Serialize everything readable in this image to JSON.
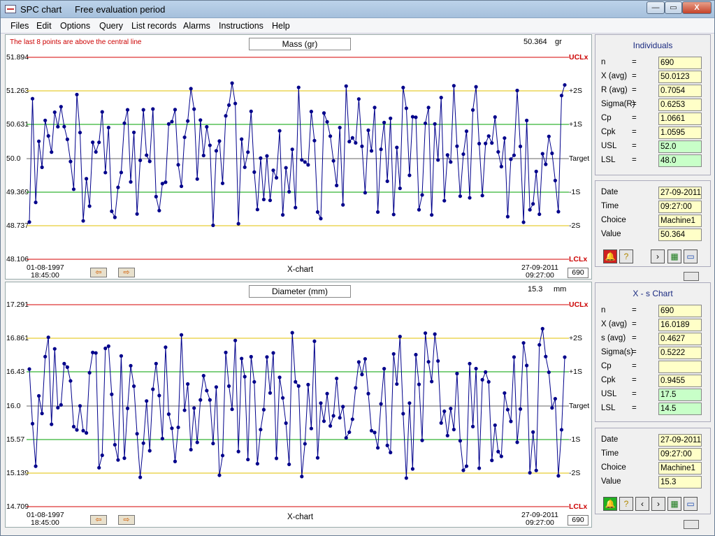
{
  "window": {
    "app_title": "SPC chart",
    "subtitle": "Free evaluation period",
    "min_glyph": "—",
    "max_glyph": "▭",
    "close_glyph": "X"
  },
  "menu": [
    "Files",
    "Edit",
    "Options",
    "Query",
    "List records",
    "Alarms",
    "Instructions",
    "Help"
  ],
  "colors": {
    "ucl": "#d40000",
    "s2": "#e0c000",
    "s1": "#00a000",
    "target": "#666666",
    "series": "#00008b",
    "alarm": "#e00000"
  },
  "chart1": {
    "alert": "The last 8 points are above the central line",
    "title": "Mass (gr)",
    "current_value": "50.364",
    "unit": "gr",
    "y_labels": [
      "51.894",
      "51.263",
      "50.631",
      "50.0",
      "49.369",
      "48.737",
      "48.106"
    ],
    "right_labels": [
      "UCLx",
      "+2S",
      "+1S",
      "Target",
      "-1S",
      "-2S",
      "LCLx"
    ],
    "start_date": "01-08-1997",
    "start_time": "18:45:00",
    "end_date": "27-09-2011",
    "end_time": "09:27:00",
    "chart_name": "X-chart",
    "count": "690"
  },
  "chart2": {
    "title": "Diameter (mm)",
    "current_value": "15.3",
    "unit": "mm",
    "y_labels": [
      "17.291",
      "16.861",
      "16.43",
      "16.0",
      "15.57",
      "15.139",
      "14.709"
    ],
    "right_labels": [
      "UCLx",
      "+2S",
      "+1S",
      "Target",
      "-1S",
      "-2S",
      "LCLx"
    ],
    "start_date": "01-08-1997",
    "start_time": "18:45:00",
    "end_date": "27-09-2011",
    "end_time": "09:27:00",
    "chart_name": "X-chart",
    "count": "690"
  },
  "stats1": {
    "title": "Individuals",
    "rows": [
      {
        "k": "n",
        "eq": "=",
        "v": "690",
        "green": false
      },
      {
        "k": "X  (avg)",
        "eq": "=",
        "v": "50.0123",
        "green": false
      },
      {
        "k": "R (avg)",
        "eq": "=",
        "v": "0.7054",
        "green": false
      },
      {
        "k": "Sigma(R)",
        "eq": "=",
        "v": "0.6253",
        "green": false
      },
      {
        "k": "Cp",
        "eq": "=",
        "v": "1.0661",
        "green": false
      },
      {
        "k": "Cpk",
        "eq": "=",
        "v": "1.0595",
        "green": false
      },
      {
        "k": "USL",
        "eq": "=",
        "v": "52.0",
        "green": true
      },
      {
        "k": "LSL",
        "eq": "=",
        "v": "48.0",
        "green": true
      }
    ]
  },
  "info1": {
    "rows": [
      {
        "k": "Date",
        "v": "27-09-2011"
      },
      {
        "k": "Time",
        "v": "09:27:00"
      },
      {
        "k": "Choice",
        "v": "Machine1"
      },
      {
        "k": "Value",
        "v": "50.364"
      }
    ],
    "buttons": [
      "alarm-bell",
      "help",
      "next",
      "excel",
      "monitor"
    ]
  },
  "stats2": {
    "title": "X - s Chart",
    "rows": [
      {
        "k": "n",
        "eq": "=",
        "v": "690",
        "green": false
      },
      {
        "k": "X  (avg)",
        "eq": "=",
        "v": "16.0189",
        "green": false
      },
      {
        "k": "s (avg)",
        "eq": "=",
        "v": "0.4627",
        "green": false
      },
      {
        "k": "Sigma(s)",
        "eq": "=",
        "v": "0.5222",
        "green": false
      },
      {
        "k": "Cp",
        "eq": "=",
        "v": "",
        "green": false
      },
      {
        "k": "Cpk",
        "eq": "=",
        "v": "0.9455",
        "green": false
      },
      {
        "k": "USL",
        "eq": "=",
        "v": "17.5",
        "green": true
      },
      {
        "k": "LSL",
        "eq": "=",
        "v": "14.5",
        "green": true
      }
    ]
  },
  "info2": {
    "rows": [
      {
        "k": "Date",
        "v": "27-09-2011"
      },
      {
        "k": "Time",
        "v": "09:27:00"
      },
      {
        "k": "Choice",
        "v": "Machine1"
      },
      {
        "k": "Value",
        "v": "15.3"
      }
    ],
    "buttons": [
      "alarm-bell",
      "help",
      "prev",
      "next",
      "excel",
      "monitor"
    ]
  }
}
